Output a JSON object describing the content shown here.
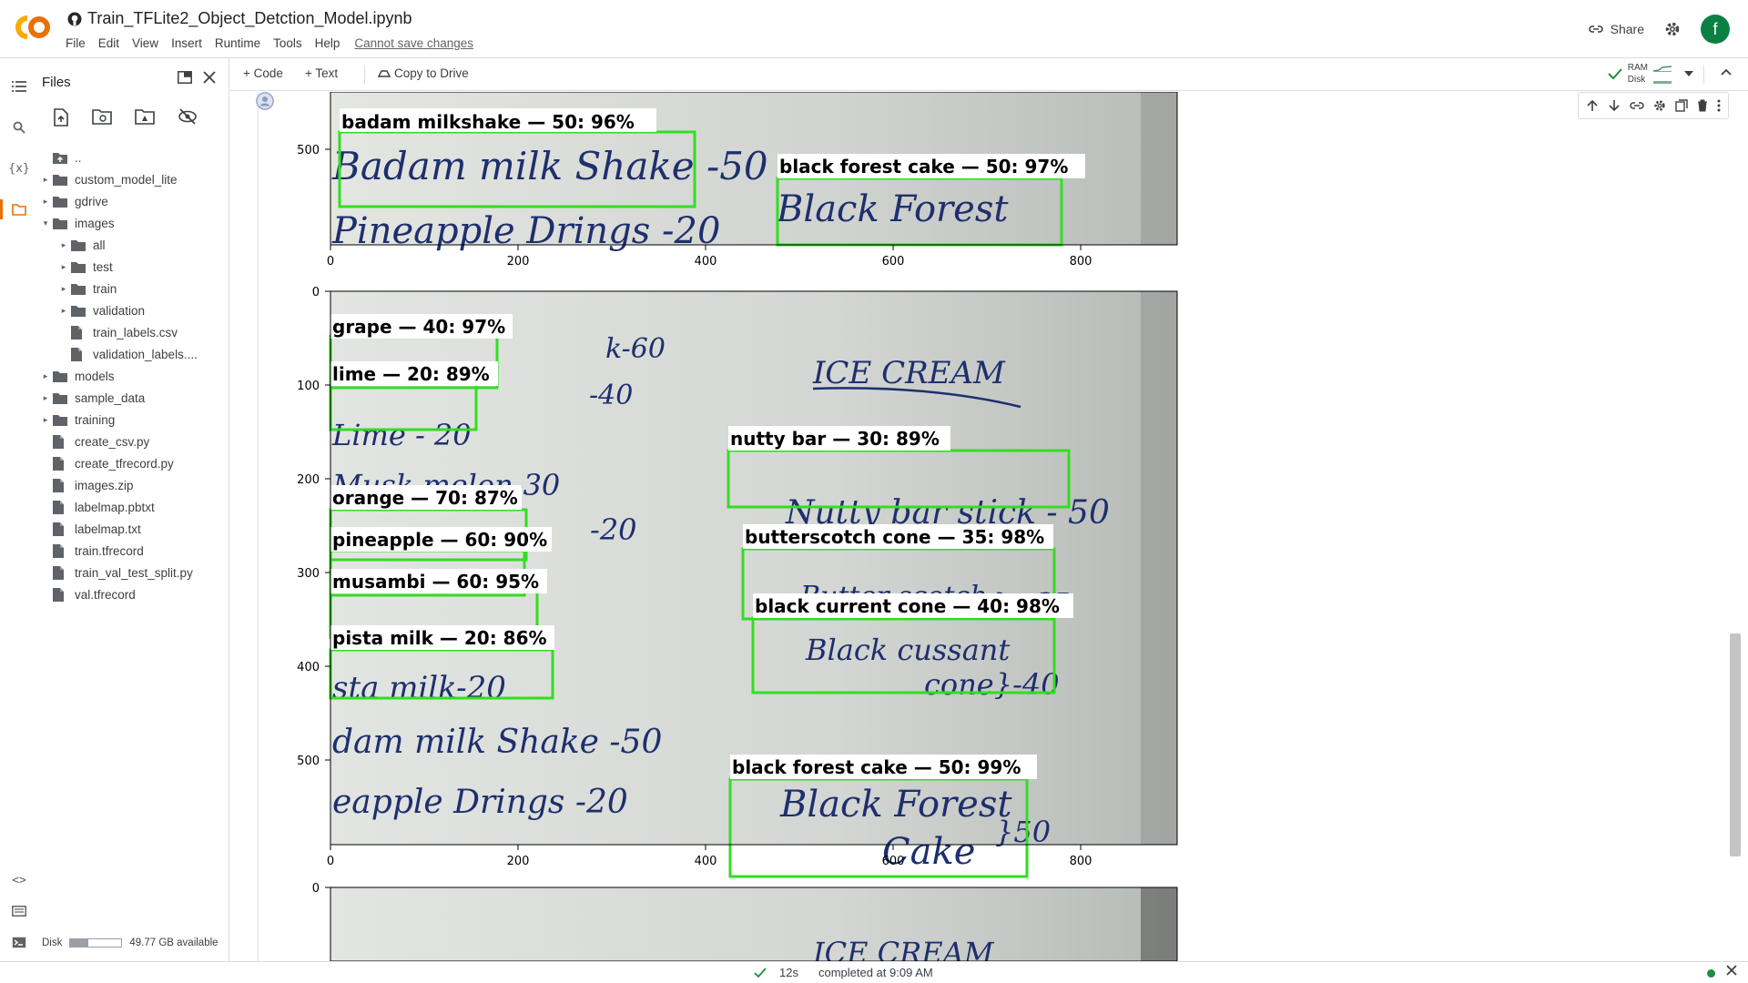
{
  "header": {
    "title": "Train_TFLite2_Object_Detction_Model.ipynb",
    "menu": [
      "File",
      "Edit",
      "View",
      "Insert",
      "Runtime",
      "Tools",
      "Help"
    ],
    "save_warning": "Cannot save changes",
    "share_label": "Share",
    "avatar_letter": "f"
  },
  "toolbar": {
    "code_label": "+ Code",
    "text_label": "+ Text",
    "copy_label": "Copy to Drive",
    "ram_label": "RAM",
    "disk_label": "Disk"
  },
  "files": {
    "title": "Files",
    "items": [
      {
        "label": "..",
        "type": "up",
        "level": 0
      },
      {
        "label": "custom_model_lite",
        "type": "folder",
        "level": 0,
        "expanded": false
      },
      {
        "label": "gdrive",
        "type": "folder",
        "level": 0,
        "expanded": false
      },
      {
        "label": "images",
        "type": "folder",
        "level": 0,
        "expanded": true
      },
      {
        "label": "all",
        "type": "folder",
        "level": 1,
        "expanded": false
      },
      {
        "label": "test",
        "type": "folder",
        "level": 1,
        "expanded": false
      },
      {
        "label": "train",
        "type": "folder",
        "level": 1,
        "expanded": false
      },
      {
        "label": "validation",
        "type": "folder",
        "level": 1,
        "expanded": false
      },
      {
        "label": "train_labels.csv",
        "type": "file",
        "level": 1
      },
      {
        "label": "validation_labels....",
        "type": "file",
        "level": 1
      },
      {
        "label": "models",
        "type": "folder",
        "level": 0,
        "expanded": false
      },
      {
        "label": "sample_data",
        "type": "folder",
        "level": 0,
        "expanded": false
      },
      {
        "label": "training",
        "type": "folder",
        "level": 0,
        "expanded": false
      },
      {
        "label": "create_csv.py",
        "type": "file",
        "level": 0
      },
      {
        "label": "create_tfrecord.py",
        "type": "file",
        "level": 0
      },
      {
        "label": "images.zip",
        "type": "file",
        "level": 0
      },
      {
        "label": "labelmap.pbtxt",
        "type": "file",
        "level": 0
      },
      {
        "label": "labelmap.txt",
        "type": "file",
        "level": 0
      },
      {
        "label": "train.tfrecord",
        "type": "file",
        "level": 0
      },
      {
        "label": "train_val_test_split.py",
        "type": "file",
        "level": 0
      },
      {
        "label": "val.tfrecord",
        "type": "file",
        "level": 0
      }
    ],
    "disk_label": "Disk",
    "disk_available": "49.77 GB available",
    "disk_used_fraction": 0.35
  },
  "plots": {
    "plot1": {
      "yticks": [
        "500"
      ],
      "xticks": [
        "0",
        "200",
        "400",
        "600",
        "800"
      ],
      "detections": [
        "badam milkshake — 50: 96%",
        "black forest cake — 50: 97%"
      ],
      "handwriting": [
        "Badam milk Shake -50",
        "Black Forest",
        "Pineapple Drings -20"
      ]
    },
    "plot2": {
      "yticks": [
        "0",
        "100",
        "200",
        "300",
        "400",
        "500"
      ],
      "xticks": [
        "0",
        "200",
        "400",
        "600",
        "800"
      ],
      "detections": [
        "grape — 40: 97%",
        "lime — 20: 89%",
        "nutty bar — 30: 89%",
        "orange — 70: 87%",
        "butterscotch cone — 35: 98%",
        "pineapple — 60: 90%",
        "musambi — 60: 95%",
        "black current cone — 40: 98%",
        "pista milk — 20: 86%",
        "black forest cake — 50: 99%"
      ],
      "handwriting": [
        "ICE CREAM",
        "Lime - 20",
        "Musk melon-30",
        "-20",
        "Nutty bar stick - 50",
        "Butter scotch",
        "} - 35",
        "Black cussant",
        "cone}-40",
        "sta milk-20",
        "dam milk Shake -50",
        "eapple Drings -20",
        "Black Forest",
        "Cake",
        "}50",
        "k-60",
        "-40"
      ]
    },
    "plot3": {
      "yticks": [
        "0"
      ],
      "handwriting": [
        "ICE CREAM"
      ]
    }
  },
  "status": {
    "elapsed": "12s",
    "completed": "completed at 9:09 AM"
  }
}
